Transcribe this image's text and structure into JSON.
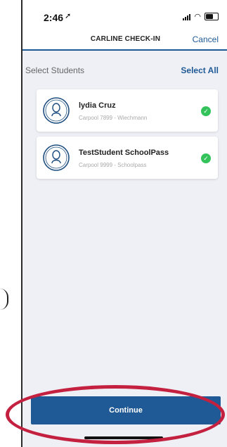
{
  "status_bar": {
    "time": "2:46"
  },
  "header": {
    "title": "CARLINE CHECK-IN",
    "cancel_label": "Cancel"
  },
  "subheader": {
    "select_students": "Select Students",
    "select_all": "Select All"
  },
  "students": [
    {
      "name": "lydia Cruz",
      "meta": "Carpool 7899 - Wiechmann",
      "selected": true
    },
    {
      "name": "TestStudent SchoolPass",
      "meta": "Carpool 9999 - Schoolpass",
      "selected": true
    }
  ],
  "footer": {
    "continue_label": "Continue"
  },
  "colors": {
    "accent": "#1f5a96",
    "check": "#34c35a",
    "annotation": "#c4203f"
  }
}
